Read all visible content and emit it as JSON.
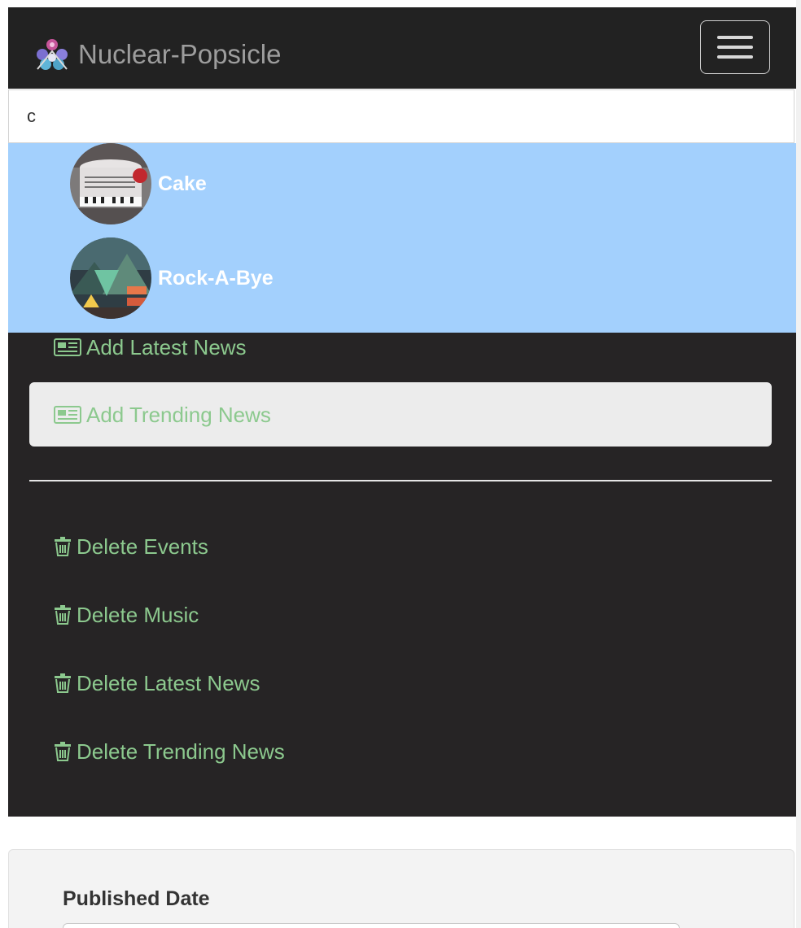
{
  "navbar": {
    "brand": "Nuclear-Popsicle",
    "brand_logo_icon": "atom-cluster-logo-icon",
    "toggle_icon": "hamburger-menu-icon"
  },
  "search": {
    "value": "c"
  },
  "search_results": [
    {
      "name": "Cake",
      "avatar": "cake-thumbnail"
    },
    {
      "name": "Rock-A-Bye",
      "avatar": "mountain-art-thumbnail"
    }
  ],
  "menu": {
    "items": [
      {
        "label": "Add Latest News",
        "icon": "newspaper-icon"
      },
      {
        "label": "Add Trending News",
        "icon": "newspaper-icon",
        "active": true
      },
      {
        "label": "Delete Events",
        "icon": "trash-icon"
      },
      {
        "label": "Delete Music",
        "icon": "trash-icon"
      },
      {
        "label": "Delete Latest News",
        "icon": "trash-icon"
      },
      {
        "label": "Delete Trending News",
        "icon": "trash-icon"
      }
    ]
  },
  "form": {
    "published_date_label": "Published Date"
  },
  "colors": {
    "navbar_bg": "#222222",
    "dropdown_bg": "#a3d0fd",
    "menu_bg": "#262425",
    "menu_link": "#8cc98e",
    "active_pill": "#ececec"
  }
}
